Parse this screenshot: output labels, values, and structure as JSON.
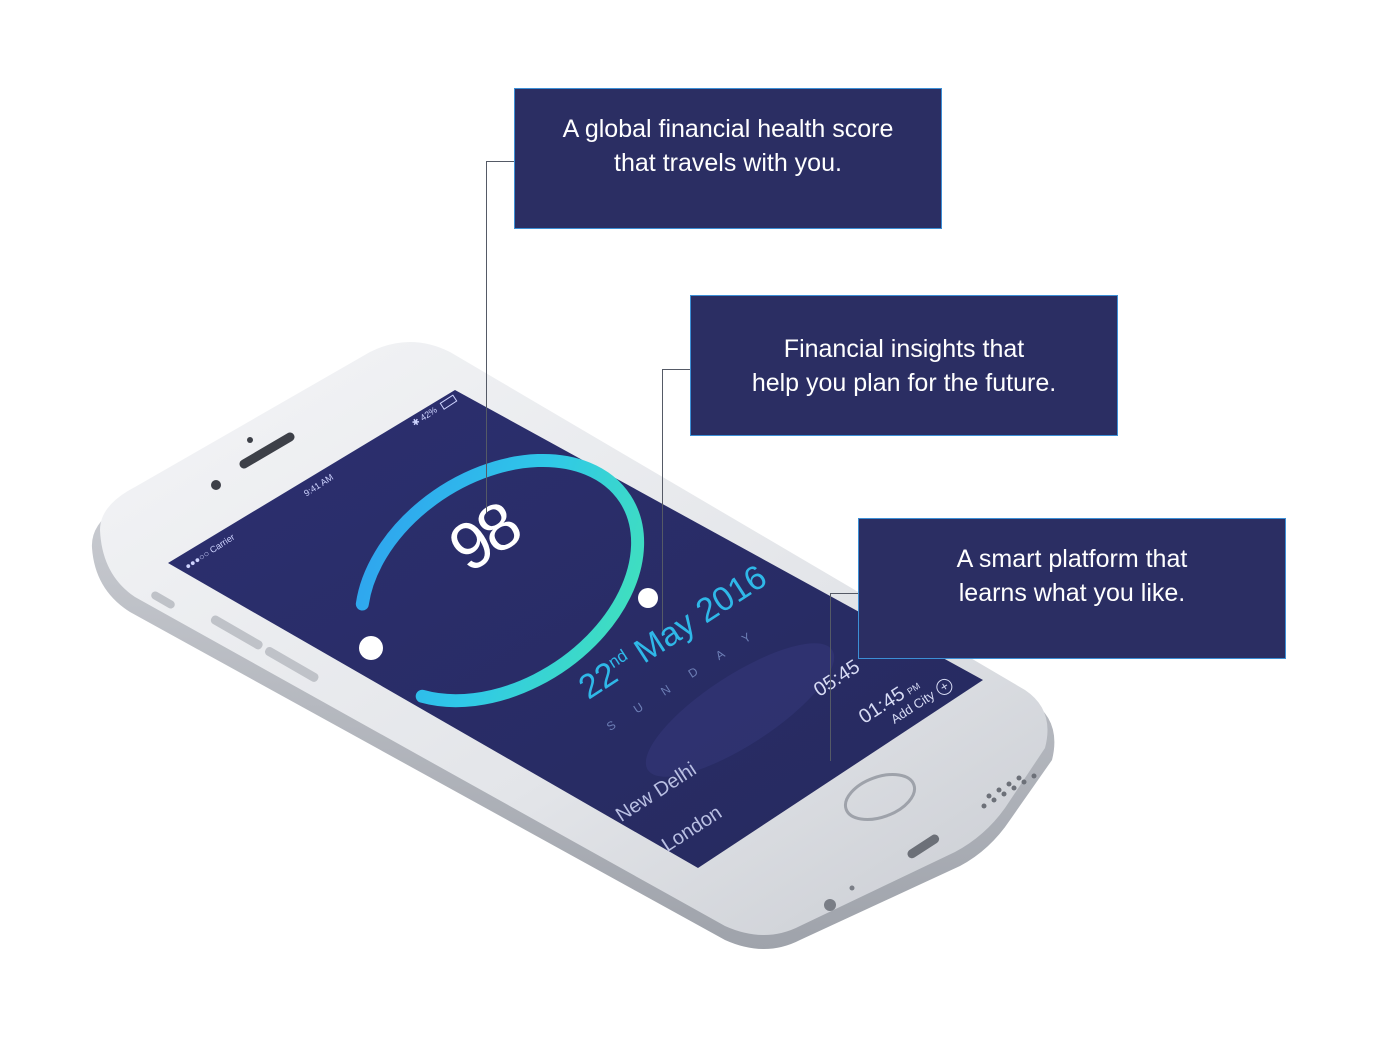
{
  "status_bar": {
    "carrier": "●●●○○ Carrier",
    "time": "9:41 AM",
    "battery": "42%"
  },
  "score": {
    "value": "98",
    "progress_fraction": 0.98
  },
  "date": {
    "day": "22",
    "suffix": "nd",
    "month_year": "May 2016",
    "weekday": "SUNDAY"
  },
  "cities": [
    {
      "name": "New Delhi",
      "time": "05:45",
      "period": ""
    },
    {
      "name": "London",
      "time": "01:45",
      "period": "PM"
    }
  ],
  "add_city": {
    "label": "Add City",
    "icon": "plus-circle-icon"
  },
  "callouts": [
    {
      "line1": "A global financial health score",
      "line2": "that travels with you."
    },
    {
      "line1": "Financial insights that",
      "line2": "help you plan for the future."
    },
    {
      "line1": "A smart platform that",
      "line2": "learns what you like."
    }
  ],
  "colors": {
    "callout_bg": "#2b2e63",
    "callout_border": "#3c8fd6",
    "screen_bg": "#2a2e6a",
    "arc_start": "#2fb8e8",
    "arc_end": "#3fe0b8",
    "date_accent": "#2fb8e8"
  }
}
